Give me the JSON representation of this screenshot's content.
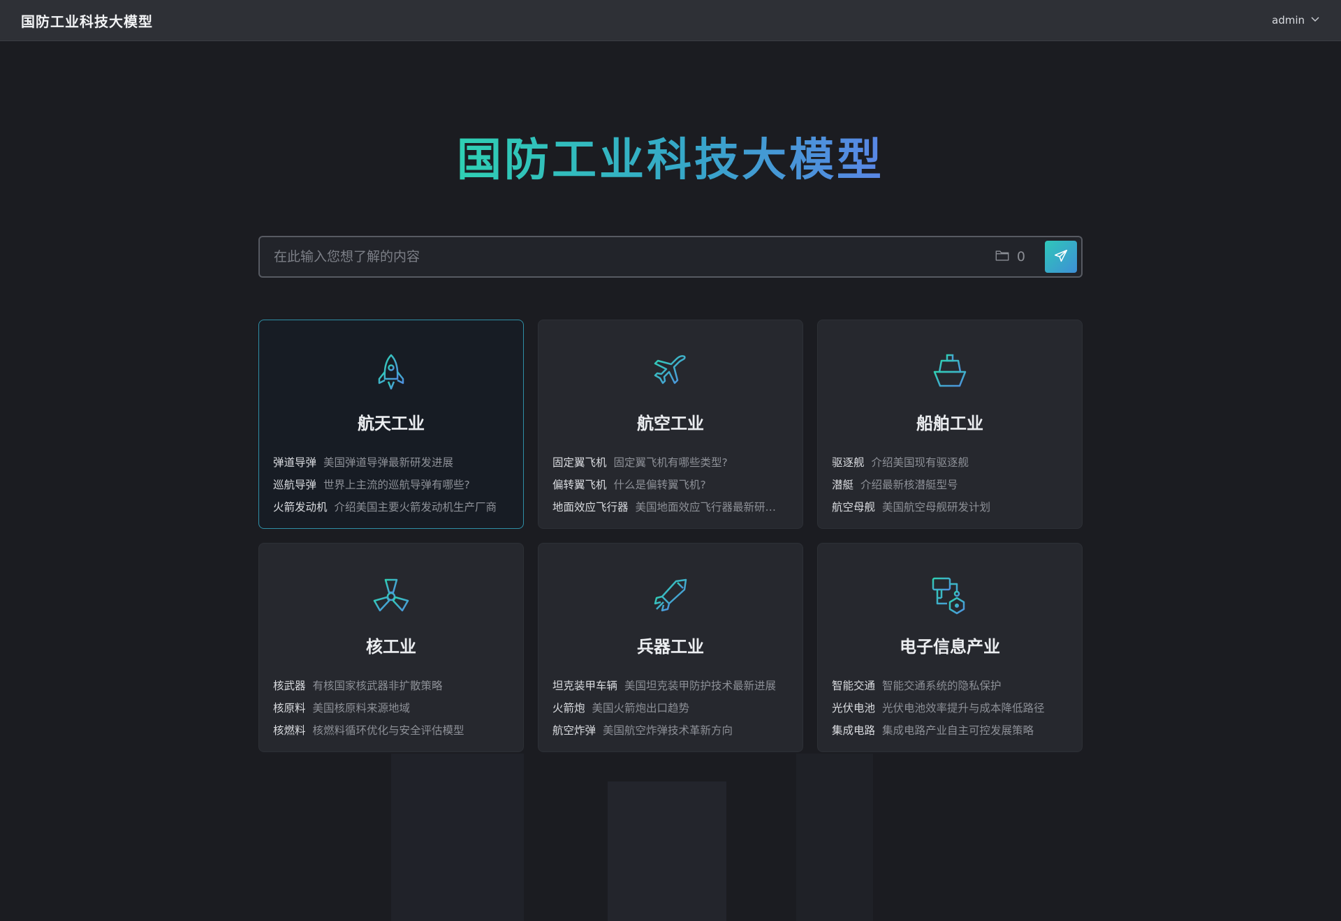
{
  "topbar": {
    "title": "国防工业科技大模型",
    "user": "admin"
  },
  "hero": {
    "title": "国防工业科技大模型"
  },
  "search": {
    "placeholder": "在此输入您想了解的内容",
    "file_count": "0"
  },
  "colors": {
    "accent_start": "#2fd0b3",
    "accent_end": "#5a86e6",
    "background": "#1b1c21",
    "card": "#26282e",
    "active_border": "#2f8fa6"
  },
  "cards": [
    {
      "title": "航天工业",
      "icon": "rocket-icon",
      "items": [
        {
          "key": "弹道导弹",
          "text": "美国弹道导弹最新研发进展"
        },
        {
          "key": "巡航导弹",
          "text": "世界上主流的巡航导弹有哪些?"
        },
        {
          "key": "火箭发动机",
          "text": "介绍美国主要火箭发动机生产厂商"
        }
      ]
    },
    {
      "title": "航空工业",
      "icon": "airplane-icon",
      "items": [
        {
          "key": "固定翼飞机",
          "text": "固定翼飞机有哪些类型?"
        },
        {
          "key": "偏转翼飞机",
          "text": "什么是偏转翼飞机?"
        },
        {
          "key": "地面效应飞行器",
          "text": "美国地面效应飞行器最新研…"
        }
      ]
    },
    {
      "title": "船舶工业",
      "icon": "ship-icon",
      "items": [
        {
          "key": "驱逐舰",
          "text": "介绍美国现有驱逐舰"
        },
        {
          "key": "潜艇",
          "text": "介绍最新核潜艇型号"
        },
        {
          "key": "航空母舰",
          "text": "美国航空母舰研发计划"
        }
      ]
    },
    {
      "title": "核工业",
      "icon": "radiation-icon",
      "items": [
        {
          "key": "核武器",
          "text": "有核国家核武器非扩散策略"
        },
        {
          "key": "核原料",
          "text": "美国核原料来源地域"
        },
        {
          "key": "核燃料",
          "text": "核燃料循环优化与安全评估模型"
        }
      ]
    },
    {
      "title": "兵器工业",
      "icon": "missile-icon",
      "items": [
        {
          "key": "坦克装甲车辆",
          "text": "美国坦克装甲防护技术最新进展"
        },
        {
          "key": "火箭炮",
          "text": "美国火箭炮出口趋势"
        },
        {
          "key": "航空炸弹",
          "text": "美国航空炸弹技术革新方向"
        }
      ]
    },
    {
      "title": "电子信息产业",
      "icon": "circuit-icon",
      "items": [
        {
          "key": "智能交通",
          "text": "智能交通系统的隐私保护"
        },
        {
          "key": "光伏电池",
          "text": "光伏电池效率提升与成本降低路径"
        },
        {
          "key": "集成电路",
          "text": "集成电路产业自主可控发展策略"
        }
      ]
    }
  ]
}
